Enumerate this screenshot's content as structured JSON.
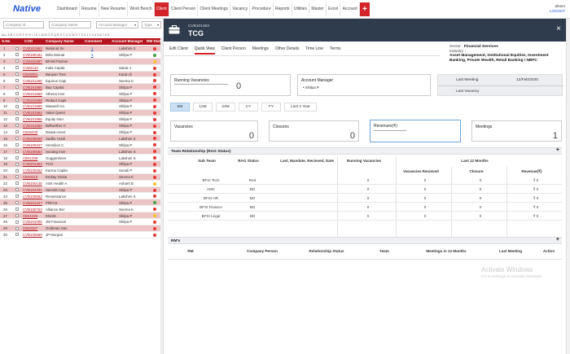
{
  "app": {
    "logo": "Native",
    "user": "ahmm",
    "logout": "LOGOUT"
  },
  "nav": [
    "Dashboard",
    "Resume",
    "New Resume",
    "Work Bench",
    "Client",
    "Client Person",
    "Client Meetings",
    "Vacancy",
    "Procedure",
    "Reports",
    "Utilities",
    "Master",
    "Excel",
    "Account"
  ],
  "nav_active": "Client",
  "filters": {
    "company_id": "Company Id",
    "company_name": "Company Name",
    "account_manager": "Account Manager",
    "type": "Type"
  },
  "alphabet": "ALL A B C D E F G H I J K L M N O P Q R S T U V W X Y Z 0 1 2 3 4 5 6 7 8 9",
  "table": {
    "headers": {
      "no": "S.No",
      "cod": "COD",
      "name": "Company Name",
      "comment": "Comment",
      "manager": "Account Manager",
      "status": "RM Stat"
    },
    "rows": [
      {
        "no": "1",
        "cod": "CVB181963",
        "name": "National Se",
        "comment": "1",
        "manager": "Lakshmi S",
        "dot": "#e53935",
        "pink": true
      },
      {
        "no": "2",
        "cod": "CVB180181",
        "name": "Birla Mutual",
        "comment": "3",
        "manager": "Shilpa P",
        "dot": "#43a047",
        "pink": false
      },
      {
        "no": "3",
        "cod": "CVB181997",
        "name": "BFAM Partner",
        "comment": "",
        "manager": "",
        "dot": "#fbc02d",
        "pink": true
      },
      {
        "no": "4",
        "cod": "CVB4133",
        "name": "India Capita",
        "comment": "",
        "manager": "Sairat J",
        "dot": "#e53935",
        "pink": false
      },
      {
        "no": "5",
        "cod": "CB46061",
        "name": "Banyan Tree",
        "comment": "",
        "manager": "Karan D",
        "dot": "#e53935",
        "pink": true
      },
      {
        "no": "6",
        "cod": "CVB101266",
        "name": "Equirus Capi",
        "comment": "",
        "manager": "Seema K",
        "dot": "#e53935",
        "pink": false
      },
      {
        "no": "7",
        "cod": "CVB191965",
        "name": "Bay Capital",
        "comment": "",
        "manager": "Shilpa P",
        "dot": "#e53935",
        "pink": true
      },
      {
        "no": "8",
        "cod": "CVB101969",
        "name": "Athena Inve",
        "comment": "",
        "manager": "Shilpa P",
        "dot": "#e53935",
        "pink": false
      },
      {
        "no": "9",
        "cod": "CVB191968",
        "name": "Redact Capit",
        "comment": "",
        "manager": "Shilpa P",
        "dot": "#e53935",
        "pink": true
      },
      {
        "no": "10",
        "cod": "CVB101969",
        "name": "Maxwell Ca",
        "comment": "",
        "manager": "Shilpa P",
        "dot": "#e53935",
        "pink": false
      },
      {
        "no": "11",
        "cod": "CVB181964",
        "name": "Value Quest",
        "comment": "",
        "manager": "Shilpa P",
        "dot": "#e53935",
        "pink": true
      },
      {
        "no": "12",
        "cod": "CVB101966",
        "name": "Equity Inter",
        "comment": "",
        "manager": "Shilpa P",
        "dot": "#e53935",
        "pink": false
      },
      {
        "no": "13",
        "cod": "CVB181954",
        "name": "Bellwether C",
        "comment": "",
        "manager": "Shilpa P",
        "dot": "#e53935",
        "pink": true
      },
      {
        "no": "14",
        "cod": "CB46449",
        "name": "Daiwa Asset",
        "comment": "",
        "manager": "Shilpa P",
        "dot": "#e53935",
        "pink": false
      },
      {
        "no": "15",
        "cod": "CVB190569",
        "name": "Sadhe Hoidi",
        "comment": "",
        "manager": "Lakshmi S",
        "dot": "#e53935",
        "pink": true
      },
      {
        "no": "16",
        "cod": "CVB100347",
        "name": "Vermilion C",
        "comment": "",
        "manager": "Shilpa P",
        "dot": "#e53935",
        "pink": false
      },
      {
        "no": "17",
        "cod": "CVB190664",
        "name": "Suvang Inve",
        "comment": "",
        "manager": "Lakshmi S",
        "dot": "#e53935",
        "pink": true
      },
      {
        "no": "18",
        "cod": "CB41039",
        "name": "Guggenheim",
        "comment": "",
        "manager": "Lakshmi S",
        "dot": "#e53935",
        "pink": false
      },
      {
        "no": "19",
        "cod": "CVB101463",
        "name": "TCG",
        "comment": "",
        "manager": "Shilpa P",
        "dot": "#e53935",
        "pink": true
      },
      {
        "no": "20",
        "cod": "CVB100262",
        "name": "Karma Capita",
        "comment": "",
        "manager": "Sonali P",
        "dot": "#e53935",
        "pink": false
      },
      {
        "no": "21",
        "cod": "CB40218",
        "name": "Emkay Globa",
        "comment": "",
        "manager": "Seema K",
        "dot": "#e53935",
        "pink": true
      },
      {
        "no": "22",
        "cod": "CVB100148",
        "name": "ASK Health A",
        "comment": "",
        "manager": "Ashant B",
        "dot": "#fbc02d",
        "pink": false
      },
      {
        "no": "23",
        "cod": "CVB181331",
        "name": "Samsitt Cap",
        "comment": "",
        "manager": "Shilpa P",
        "dot": "#e53935",
        "pink": true
      },
      {
        "no": "24",
        "cod": "CVB100662",
        "name": "Renaissance",
        "comment": "",
        "manager": "Lakshmi S",
        "dot": "#e53935",
        "pink": false
      },
      {
        "no": "25",
        "cod": "CVB101427",
        "name": "PRFAS",
        "comment": "",
        "manager": "Shilpa P",
        "dot": "#43a047",
        "pink": true
      },
      {
        "no": "26",
        "cod": "CVB100763",
        "name": "Alliance Ber",
        "comment": "",
        "manager": "Seema K",
        "dot": "#e53935",
        "pink": false
      },
      {
        "no": "27",
        "cod": "CB41169",
        "name": "ENAM",
        "comment": "",
        "manager": "Shilpa P",
        "dot": "#fbc02d",
        "pink": true
      },
      {
        "no": "28",
        "cod": "CVB101005",
        "name": "JM Financial",
        "comment": "",
        "manager": "Shilpa P",
        "dot": "#e53935",
        "pink": false
      },
      {
        "no": "29",
        "cod": "CB40347",
        "name": "Goldman Sac",
        "comment": "",
        "manager": "",
        "dot": "#e53935",
        "pink": true
      },
      {
        "no": "30",
        "cod": "CVB100669",
        "name": "JP Morgan",
        "comment": "",
        "manager": "",
        "dot": "#e53935",
        "pink": false
      }
    ]
  },
  "client": {
    "code": "CVB101463",
    "name": "TCG",
    "tabs": [
      "Edit Client",
      "Quick View",
      "Client Person",
      "Meetings",
      "Other Details",
      "Time Line",
      "Terms"
    ],
    "active_tab": "Quick View",
    "sector_label": "Sector :",
    "sector_value": "Financial Services",
    "industry_label": "Industry :",
    "industry_value": "Asset Management, Institutional Equities, Investment Banking, Private Wealth, Retail Banking / NBFC",
    "running_vacancies_label": "Running Vacancies",
    "running_vacancies": "0",
    "account_manager_label": "Account Manager",
    "account_manager": "Shilpa P",
    "last_meeting_label": "Last Meeting",
    "last_meeting": "12/Feb/2020",
    "last_vacancy_label": "Last Vacancy",
    "last_vacancy": "",
    "periods": [
      "6M",
      "12M",
      "24M",
      "CY",
      "FY",
      "Last 2 Year"
    ],
    "active_period": "6M",
    "stats": [
      {
        "label": "Vacancies",
        "value": "0"
      },
      {
        "label": "Closures",
        "value": "0"
      },
      {
        "label": "Revenues(₹)",
        "value": ""
      },
      {
        "label": "Meetings",
        "value": "1"
      }
    ]
  },
  "team": {
    "title": "Team Relationship (RAG Status)",
    "plus": "+",
    "headers": {
      "sub_team": "Sub Team",
      "rag": "RAG Status",
      "last": "Last, Mandate, Recieved, Date",
      "running": "Running Vacancies",
      "period": "Last 12 Months",
      "vac": "Vacancies Recieved",
      "closure": "Closure",
      "revenue": "Revenue(₹)"
    },
    "rows": [
      {
        "sub_team": "BFSI Tech",
        "rag": "Red",
        "last": "",
        "running": "0",
        "vac": "0",
        "closure": "0",
        "revenue": "₹ 0"
      },
      {
        "sub_team": "AMC",
        "rag": "BD",
        "last": "",
        "running": "0",
        "vac": "0",
        "closure": "0",
        "revenue": "₹ 0"
      },
      {
        "sub_team": "BFSI HR",
        "rag": "BD",
        "last": "",
        "running": "0",
        "vac": "0",
        "closure": "0",
        "revenue": "₹ 0"
      },
      {
        "sub_team": "BFSI Finance",
        "rag": "BD",
        "last": "",
        "running": "0",
        "vac": "0",
        "closure": "0",
        "revenue": "₹ 0"
      },
      {
        "sub_team": "BFSI Legal",
        "rag": "BD",
        "last": "",
        "running": "0",
        "vac": "0",
        "closure": "0",
        "revenue": "₹ 0"
      }
    ]
  },
  "rms": {
    "title": "RM's",
    "plus": "+",
    "headers": {
      "rm": "RM",
      "company_person": "Company Person",
      "relationship": "Relationship Status",
      "team": "Team",
      "meetings": "Meetings in 12 Months",
      "last_meeting": "Last Meeting",
      "action": "Action"
    }
  },
  "watermark": {
    "title": "Activate Windows",
    "sub": "Go to Settings to activate Windows."
  },
  "colors": {
    "brand": "#1b4fd8",
    "accent": "#d3242a",
    "header": "#2f3c4e",
    "table_head": "#b5131d"
  }
}
